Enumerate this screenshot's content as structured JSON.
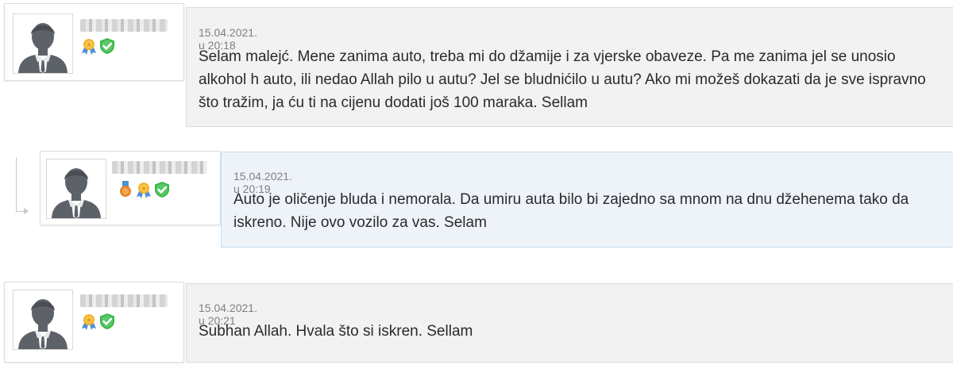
{
  "comments": [
    {
      "timestamp": "15.04.2021. u 20:18",
      "text": "Selam malejć. Mene zanima auto, treba mi do džamije i za vjerske obaveze. Pa me zanima jel se unosio alkohol h auto, ili nedao Allah pilo u autu? Jel se bludnićilo u autu? Ako mi možeš dokazati da je sve ispravno što tražim, ja ću ti na cijenu dodati još 100 maraka. Sellam",
      "badges": [
        "award-icon",
        "verified-shield-icon"
      ]
    },
    {
      "timestamp": "15.04.2021. u 20:19",
      "text": "Auto je oličenje bluda i nemorala. Da umiru auta bilo bi zajedno sa mnom na dnu džehenema tako da iskreno. Nije ovo vozilo za vas. Selam",
      "badges": [
        "medal-icon",
        "award-icon",
        "verified-shield-icon"
      ],
      "is_reply": true
    },
    {
      "timestamp": "15.04.2021. u 20:21",
      "text": "Subhan Allah. Hvala što si iskren. Sellam",
      "badges": [
        "award-icon",
        "verified-shield-icon"
      ]
    }
  ],
  "colors": {
    "bubble_bg": "#f2f2f2",
    "reply_bubble_bg": "#eef3fa",
    "reply_border": "#c5dcef",
    "verified_green": "#3bb54a"
  }
}
